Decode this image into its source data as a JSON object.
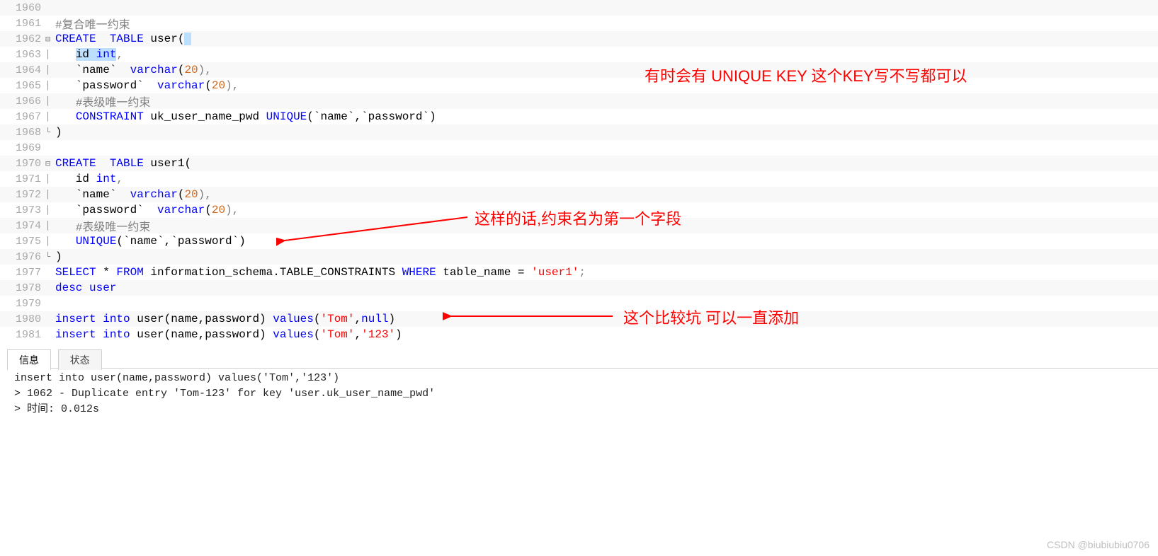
{
  "code_lines": [
    {
      "n": "1960",
      "fold": "",
      "bg": 1,
      "tokens": []
    },
    {
      "n": "1961",
      "fold": "",
      "bg": 0,
      "tokens": [
        {
          "t": "#复合唯一约束",
          "c": "cmt"
        }
      ]
    },
    {
      "n": "1962",
      "fold": "⊟",
      "bg": 1,
      "tokens": [
        {
          "t": "CREATE",
          "c": "kw"
        },
        {
          "t": "  "
        },
        {
          "t": "TABLE",
          "c": "kw"
        },
        {
          "t": " user("
        },
        {
          "t": " ",
          "c": "",
          "sel": true
        }
      ]
    },
    {
      "n": "1963",
      "fold": "|",
      "bg": 0,
      "tokens": [
        {
          "t": "   "
        },
        {
          "t": "id ",
          "c": "",
          "sel": true
        },
        {
          "t": "int",
          "c": "kw",
          "sel": true
        },
        {
          "t": ",",
          "c": "punc"
        }
      ]
    },
    {
      "n": "1964",
      "fold": "|",
      "bg": 1,
      "tokens": [
        {
          "t": "   `name`  "
        },
        {
          "t": "varchar",
          "c": "kw"
        },
        {
          "t": "("
        },
        {
          "t": "20",
          "c": "num"
        },
        {
          "t": "),",
          "c": "punc"
        }
      ]
    },
    {
      "n": "1965",
      "fold": "|",
      "bg": 0,
      "tokens": [
        {
          "t": "   `password`  "
        },
        {
          "t": "varchar",
          "c": "kw"
        },
        {
          "t": "("
        },
        {
          "t": "20",
          "c": "num"
        },
        {
          "t": "),",
          "c": "punc"
        }
      ]
    },
    {
      "n": "1966",
      "fold": "|",
      "bg": 1,
      "tokens": [
        {
          "t": "   "
        },
        {
          "t": "#表级唯一约束",
          "c": "cmt"
        }
      ]
    },
    {
      "n": "1967",
      "fold": "|",
      "bg": 0,
      "tokens": [
        {
          "t": "   "
        },
        {
          "t": "CONSTRAINT",
          "c": "kw"
        },
        {
          "t": " uk_user_name_pwd "
        },
        {
          "t": "UNIQUE",
          "c": "kw"
        },
        {
          "t": "(`name`,`password`)"
        }
      ]
    },
    {
      "n": "1968",
      "fold": "└",
      "bg": 1,
      "tokens": [
        {
          "t": ")"
        }
      ]
    },
    {
      "n": "1969",
      "fold": "",
      "bg": 0,
      "tokens": []
    },
    {
      "n": "1970",
      "fold": "⊟",
      "bg": 1,
      "tokens": [
        {
          "t": "CREATE",
          "c": "kw"
        },
        {
          "t": "  "
        },
        {
          "t": "TABLE",
          "c": "kw"
        },
        {
          "t": " user1("
        }
      ]
    },
    {
      "n": "1971",
      "fold": "|",
      "bg": 0,
      "tokens": [
        {
          "t": "   id "
        },
        {
          "t": "int",
          "c": "kw"
        },
        {
          "t": ",",
          "c": "punc"
        }
      ]
    },
    {
      "n": "1972",
      "fold": "|",
      "bg": 1,
      "tokens": [
        {
          "t": "   `name`  "
        },
        {
          "t": "varchar",
          "c": "kw"
        },
        {
          "t": "("
        },
        {
          "t": "20",
          "c": "num"
        },
        {
          "t": "),",
          "c": "punc"
        }
      ]
    },
    {
      "n": "1973",
      "fold": "|",
      "bg": 0,
      "tokens": [
        {
          "t": "   `password`  "
        },
        {
          "t": "varchar",
          "c": "kw"
        },
        {
          "t": "("
        },
        {
          "t": "20",
          "c": "num"
        },
        {
          "t": "),",
          "c": "punc"
        }
      ]
    },
    {
      "n": "1974",
      "fold": "|",
      "bg": 1,
      "tokens": [
        {
          "t": "   "
        },
        {
          "t": "#表级唯一约束",
          "c": "cmt"
        }
      ]
    },
    {
      "n": "1975",
      "fold": "|",
      "bg": 0,
      "tokens": [
        {
          "t": "   "
        },
        {
          "t": "UNIQUE",
          "c": "kw"
        },
        {
          "t": "(`name`,`password`)"
        }
      ]
    },
    {
      "n": "1976",
      "fold": "└",
      "bg": 1,
      "tokens": [
        {
          "t": ")"
        }
      ]
    },
    {
      "n": "1977",
      "fold": "",
      "bg": 0,
      "tokens": [
        {
          "t": "SELECT",
          "c": "kw"
        },
        {
          "t": " * "
        },
        {
          "t": "FROM",
          "c": "kw"
        },
        {
          "t": " information_schema.TABLE_CONSTRAINTS "
        },
        {
          "t": "WHERE",
          "c": "kw"
        },
        {
          "t": " table_name = "
        },
        {
          "t": "'user1'",
          "c": "str"
        },
        {
          "t": ";",
          "c": "punc"
        }
      ]
    },
    {
      "n": "1978",
      "fold": "",
      "bg": 1,
      "tokens": [
        {
          "t": "desc",
          "c": "kw"
        },
        {
          "t": " "
        },
        {
          "t": "user",
          "c": "kw"
        }
      ]
    },
    {
      "n": "1979",
      "fold": "",
      "bg": 0,
      "tokens": []
    },
    {
      "n": "1980",
      "fold": "",
      "bg": 1,
      "tokens": [
        {
          "t": "insert",
          "c": "kw"
        },
        {
          "t": " "
        },
        {
          "t": "into",
          "c": "kw"
        },
        {
          "t": " user(name,password) "
        },
        {
          "t": "values",
          "c": "kw"
        },
        {
          "t": "("
        },
        {
          "t": "'Tom'",
          "c": "str"
        },
        {
          "t": ","
        },
        {
          "t": "null",
          "c": "kw"
        },
        {
          "t": ")"
        }
      ]
    },
    {
      "n": "1981",
      "fold": "",
      "bg": 0,
      "tokens": [
        {
          "t": "insert",
          "c": "kw"
        },
        {
          "t": " "
        },
        {
          "t": "into",
          "c": "kw"
        },
        {
          "t": " user(name,password) "
        },
        {
          "t": "values",
          "c": "kw"
        },
        {
          "t": "("
        },
        {
          "t": "'Tom'",
          "c": "str"
        },
        {
          "t": ","
        },
        {
          "t": "'123'",
          "c": "str"
        },
        {
          "t": ")"
        }
      ]
    }
  ],
  "annotations": {
    "a1": "有时会有 UNIQUE KEY   这个KEY写不写都可以",
    "a2": "这样的话,约束名为第一个字段",
    "a3": "这个比较坑  可以一直添加"
  },
  "tabs": {
    "info": "信息",
    "status": "状态"
  },
  "output_lines": [
    "insert into user(name,password) values('Tom','123')",
    "> 1062 - Duplicate entry 'Tom-123' for key 'user.uk_user_name_pwd'",
    "> 时间: 0.012s"
  ],
  "watermark": "CSDN @biubiubiu0706"
}
